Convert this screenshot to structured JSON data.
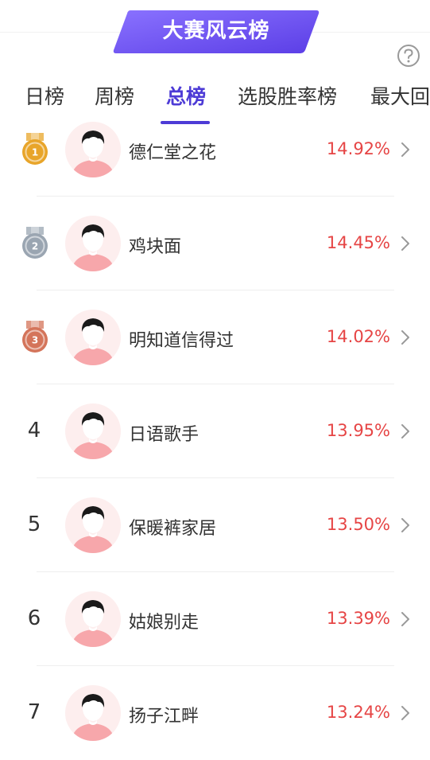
{
  "header": {
    "title": "大赛风云榜"
  },
  "tabs": [
    {
      "label": "日榜",
      "active": false
    },
    {
      "label": "周榜",
      "active": false
    },
    {
      "label": "总榜",
      "active": true
    },
    {
      "label": "选股胜率榜",
      "active": false
    },
    {
      "label": "最大回",
      "active": false
    }
  ],
  "rows": [
    {
      "rank": "1",
      "medal": "gold-medal-icon",
      "name": "德仁堂之花",
      "pct": "14.92%"
    },
    {
      "rank": "2",
      "medal": "silver-medal-icon",
      "name": "鸡块面",
      "pct": "14.45%"
    },
    {
      "rank": "3",
      "medal": "bronze-medal-icon",
      "name": "明知道信得过",
      "pct": "14.02%"
    },
    {
      "rank": "4",
      "name": "日语歌手",
      "pct": "13.95%"
    },
    {
      "rank": "5",
      "name": "保暖裤家居",
      "pct": "13.50%"
    },
    {
      "rank": "6",
      "name": "姑娘别走",
      "pct": "13.39%"
    },
    {
      "rank": "7",
      "name": "扬子江畔",
      "pct": "13.24%"
    }
  ],
  "colors": {
    "accent": "#4d3bd6",
    "positive": "#e64545",
    "gold": "#e8a52a",
    "silver": "#9aa5b1",
    "bronze": "#d4745a"
  }
}
